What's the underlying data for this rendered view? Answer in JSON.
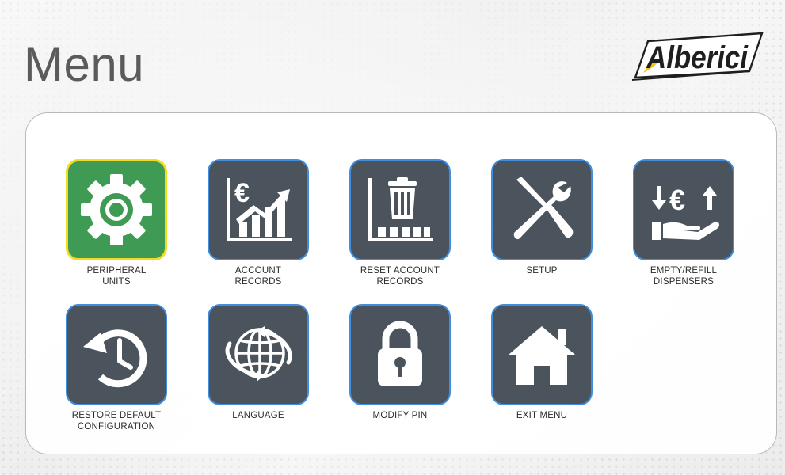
{
  "page": {
    "title": "Menu"
  },
  "brand": {
    "logo_text": "Alberici",
    "logo_color": "#1f1f1f",
    "logo_accent": "#f2c21a"
  },
  "menu": {
    "tiles": [
      {
        "id": "peripheral-units",
        "label_lines": [
          "PERIPHERAL",
          "UNITS"
        ],
        "icon": "gear-icon",
        "selected": true
      },
      {
        "id": "account-records",
        "label_lines": [
          "ACCOUNT",
          "RECORDS"
        ],
        "icon": "euro-chart-icon",
        "selected": false
      },
      {
        "id": "reset-account-records",
        "label_lines": [
          "RESET ACCOUNT",
          "RECORDS"
        ],
        "icon": "trash-chart-icon",
        "selected": false
      },
      {
        "id": "setup",
        "label_lines": [
          "SETUP"
        ],
        "icon": "tools-icon",
        "selected": false
      },
      {
        "id": "empty-refill-dispensers",
        "label_lines": [
          "EMPTY/REFILL",
          "DISPENSERS"
        ],
        "icon": "euro-hand-icon",
        "selected": false
      },
      {
        "id": "restore-default-configuration",
        "label_lines": [
          "RESTORE DEFAULT",
          "CONFIGURATION"
        ],
        "icon": "history-icon",
        "selected": false
      },
      {
        "id": "language",
        "label_lines": [
          "LANGUAGE"
        ],
        "icon": "globe-icon",
        "selected": false
      },
      {
        "id": "modify-pin",
        "label_lines": [
          "MODIFY PIN"
        ],
        "icon": "lock-icon",
        "selected": false
      },
      {
        "id": "exit-menu",
        "label_lines": [
          "EXIT MENU"
        ],
        "icon": "home-icon",
        "selected": false
      }
    ]
  },
  "colors": {
    "tile_bg": "#4b545d",
    "tile_border": "#3f8ee0",
    "selected_bg": "#3f9b53",
    "selected_border": "#f3dc1b"
  }
}
